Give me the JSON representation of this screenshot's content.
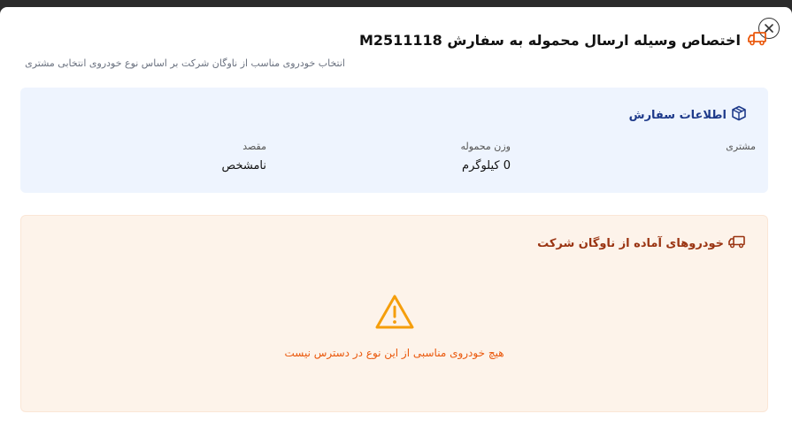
{
  "dialog": {
    "title": "اختصاص وسیله ارسال محموله به سفارش M2511118",
    "subtitle": "انتخاب خودروی مناسب از ناوگان شرکت بر اساس نوع خودروی انتخابی مشتری",
    "close_icon": "close-icon"
  },
  "order_info": {
    "title": "اطلاعات سفارش",
    "icon": "box-icon",
    "fields": [
      {
        "label": "مشتری",
        "value": ""
      },
      {
        "label": "وزن محموله",
        "value": "0 کیلوگرم"
      },
      {
        "label": "مقصد",
        "value": "نامشخص"
      }
    ]
  },
  "fleet": {
    "title": "خودروهای آماده از ناوگان شرکت",
    "icon": "truck-icon",
    "empty_icon": "warning-icon",
    "empty_message": "هیچ خودروی مناسبی از این نوع در دسترس نیست"
  },
  "colors": {
    "accent_orange": "#ea580c",
    "info_bg": "#eef4fe",
    "info_title": "#1e3a8a",
    "fleet_bg": "#fdf3ea",
    "warning": "#f59e0b"
  }
}
